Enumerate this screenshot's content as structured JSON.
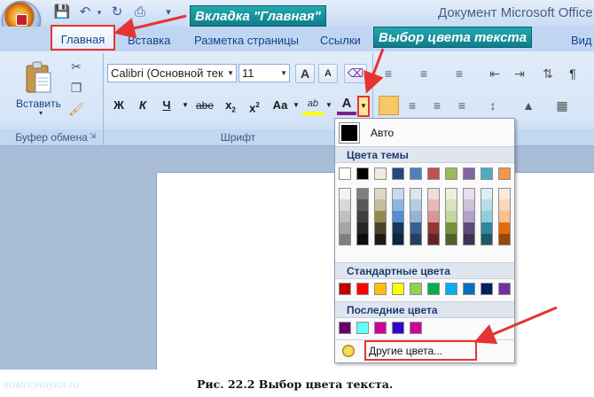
{
  "window": {
    "title": "Документ Microsoft Office"
  },
  "quick_access": {
    "items": [
      "save-icon",
      "undo-icon",
      "redo-icon",
      "print-icon",
      "customize-icon"
    ]
  },
  "tabs": [
    {
      "label": "Главная",
      "active": true
    },
    {
      "label": "Вставка"
    },
    {
      "label": "Разметка страницы"
    },
    {
      "label": "Ссылки"
    },
    {
      "label": "Вид"
    }
  ],
  "clipboard": {
    "paste_label": "Вставить",
    "group_label": "Буфер обмена"
  },
  "font_group": {
    "font_name": "Calibri (Основной тек",
    "font_size": "11",
    "bold": "Ж",
    "italic": "К",
    "underline": "Ч",
    "strike": "abe",
    "subscript_base": "x",
    "subscript_mark": "2",
    "superscript_base": "x",
    "superscript_mark": "2",
    "case_label": "Аа",
    "grow_label": "A",
    "shrink_label": "A",
    "highlight_label": "ab",
    "font_color_label": "A",
    "group_label": "Шрифт"
  },
  "paragraph_group": {
    "pilcrow": "¶"
  },
  "callouts": {
    "home_tab": "Вкладка \"Главная\"",
    "color_picker": "Выбор цвета текста"
  },
  "color_menu": {
    "auto_label": "Авто",
    "theme_header": "Цвета темы",
    "standard_header": "Стандартные цвета",
    "recent_header": "Последние цвета",
    "more_label": "Другие цвета...",
    "theme_colors": [
      [
        "#ffffff",
        "#f2f2f2",
        "#d8d8d8",
        "#bfbfbf",
        "#a5a5a5",
        "#7f7f7f"
      ],
      [
        "#000000",
        "#7f7f7f",
        "#595959",
        "#3f3f3f",
        "#262626",
        "#0c0c0c"
      ],
      [
        "#eeece1",
        "#ddd9c3",
        "#c4bd97",
        "#938953",
        "#494429",
        "#1d1b10"
      ],
      [
        "#1f497d",
        "#c6d9f0",
        "#8db3e2",
        "#548dd4",
        "#17365d",
        "#0f243e"
      ],
      [
        "#4f81bd",
        "#dbe5f1",
        "#b8cce4",
        "#95b3d7",
        "#366092",
        "#244061"
      ],
      [
        "#c0504d",
        "#f2dcdb",
        "#e5b9b7",
        "#d99694",
        "#953734",
        "#632423"
      ],
      [
        "#9bbb59",
        "#ebf1dd",
        "#d7e3bc",
        "#c3d69b",
        "#76923c",
        "#4f6128"
      ],
      [
        "#8064a2",
        "#e5e0ec",
        "#ccc1d9",
        "#b2a2c7",
        "#5f497a",
        "#3f3151"
      ],
      [
        "#4bacc6",
        "#dbeef3",
        "#b7dde8",
        "#92cddc",
        "#31859b",
        "#205867"
      ],
      [
        "#f79646",
        "#fdeada",
        "#fbd5b5",
        "#fac08f",
        "#e36c09",
        "#974806"
      ]
    ],
    "standard_colors": [
      "#c00000",
      "#ff0000",
      "#ffc000",
      "#ffff00",
      "#92d050",
      "#00b050",
      "#00b0f0",
      "#0070c0",
      "#002060",
      "#7030a0"
    ],
    "recent_colors": [
      "#660066",
      "#66ffff",
      "#cc0099",
      "#3300cc",
      "#cc0099"
    ]
  },
  "footer": {
    "watermark": "компонаука.ru",
    "caption": "Рис. 22.2 Выбор цвета текста."
  },
  "accent": {
    "red": "#e53433",
    "teal": "#1398a3"
  }
}
